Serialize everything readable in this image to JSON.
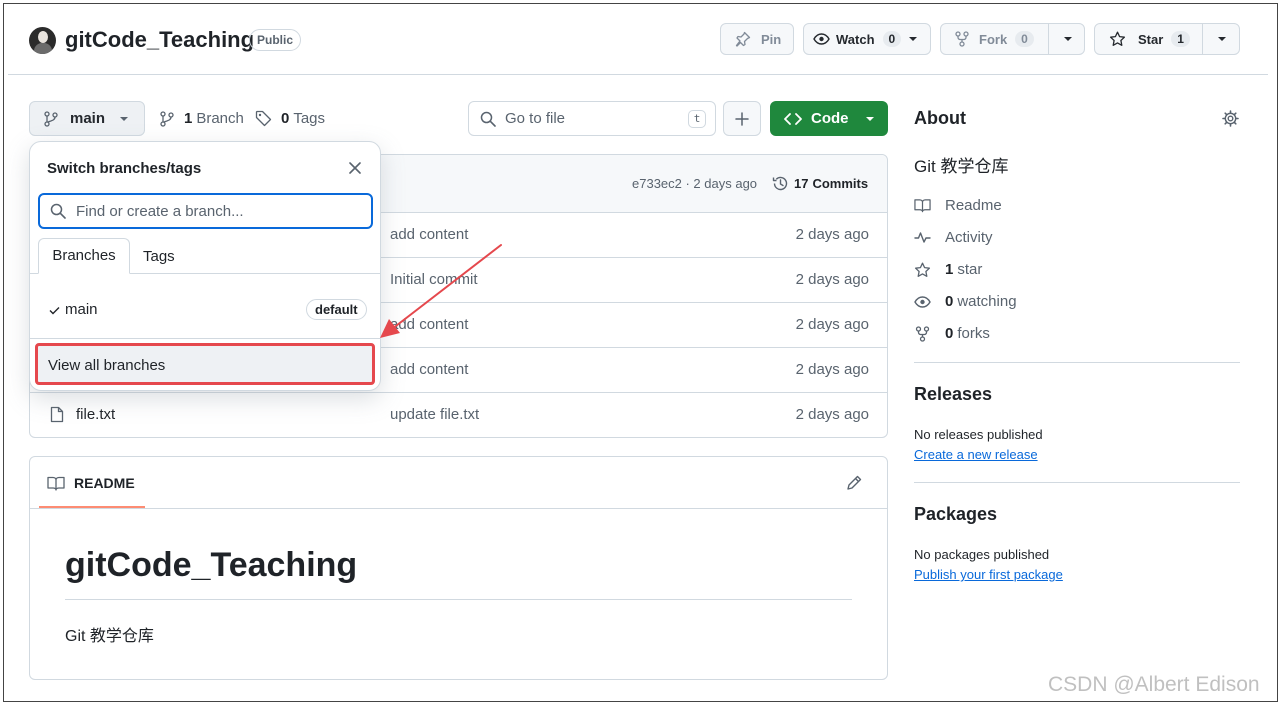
{
  "repo": {
    "name": "gitCode_Teaching",
    "visibility": "Public"
  },
  "header_actions": {
    "pin": "Pin",
    "watch": "Watch",
    "watch_count": "0",
    "fork": "Fork",
    "fork_count": "0",
    "star": "Star",
    "star_count": "1"
  },
  "toolbar": {
    "branch": "main",
    "branch_count": "1",
    "branch_label": "Branch",
    "tag_count": "0",
    "tag_label": "Tags",
    "go_to_file": "Go to file",
    "go_to_file_key": "t",
    "code": "Code"
  },
  "commit_bar": {
    "hash_time": "e733ec2 · 2 days ago",
    "commits_count": "17",
    "commits_label": "Commits"
  },
  "files": [
    {
      "name": "",
      "message": "add content",
      "date": "2 days ago"
    },
    {
      "name": "",
      "message": "Initial commit",
      "date": "2 days ago"
    },
    {
      "name": "",
      "message": "add content",
      "date": "2 days ago"
    },
    {
      "name": "",
      "message": "add content",
      "date": "2 days ago"
    },
    {
      "name": "file.txt",
      "message": "update file.txt",
      "date": "2 days ago"
    }
  ],
  "branch_dropdown": {
    "title": "Switch branches/tags",
    "search_placeholder": "Find or create a branch...",
    "tabs": [
      "Branches",
      "Tags"
    ],
    "branches": [
      {
        "name": "main",
        "badge": "default"
      }
    ],
    "view_all": "View all branches"
  },
  "readme": {
    "tab": "README",
    "heading": "gitCode_Teaching",
    "body": "Git 教学仓库"
  },
  "about": {
    "title": "About",
    "description": "Git 教学仓库",
    "links": {
      "readme": "Readme",
      "activity": "Activity",
      "stars_count": "1",
      "stars_label": "star",
      "watching_count": "0",
      "watching_label": "watching",
      "forks_count": "0",
      "forks_label": "forks"
    }
  },
  "releases": {
    "title": "Releases",
    "empty": "No releases published",
    "link": "Create a new release"
  },
  "packages": {
    "title": "Packages",
    "empty": "No packages published",
    "link": "Publish your first package"
  },
  "watermark": "CSDN @Albert Edison",
  "colors": {
    "accent_green": "#1f883d",
    "link_blue": "#0969da",
    "focus_blue": "#0969da",
    "annotation_red": "#e5484d"
  }
}
